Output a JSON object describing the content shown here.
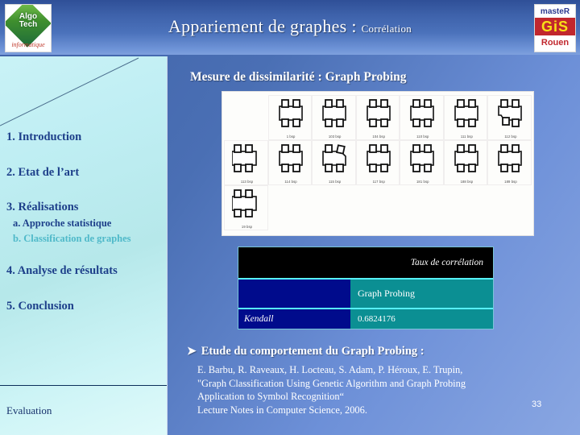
{
  "header": {
    "title_main": "Appariement de graphes : ",
    "title_sub": "Corrélation",
    "logo_left": {
      "name": "algotech-logo",
      "line1": "Algo",
      "line2": "Tech",
      "script": "informatique"
    },
    "logo_right": {
      "name": "master-gis-rouen-logo",
      "line1": "masteR",
      "line2": "GiS",
      "line3": "Rouen"
    }
  },
  "sidebar": {
    "items": [
      {
        "label": "1. Introduction",
        "level": 0,
        "highlight": false
      },
      {
        "label": "2. Etat de l’art",
        "level": 0,
        "highlight": false
      },
      {
        "label": "3. Réalisations",
        "level": 0,
        "highlight": false
      },
      {
        "label": "a. Approche statistique",
        "level": 1,
        "highlight": false
      },
      {
        "label": "b. Classification de graphes",
        "level": 1,
        "highlight": true
      },
      {
        "label": "4. Analyse de résultats",
        "level": 0,
        "highlight": false
      },
      {
        "label": "5. Conclusion",
        "level": 0,
        "highlight": false
      }
    ],
    "footer_label": "Evaluation"
  },
  "main": {
    "content_title": "Mesure de dissimilarité : Graph Probing",
    "symbol_panel": {
      "name": "symbol-image-grid",
      "captions_row1": [
        "",
        "1 bsp",
        "103 bsp",
        "104 bsp",
        "110 bsp",
        "111 bsp",
        "112 bsp"
      ],
      "captions_row2": [
        "113 bsp",
        "114 bsp",
        "115 bsp",
        "117 bsp",
        "181 bsp",
        "188 bsp",
        "189 bsp"
      ],
      "captions_row3": [
        "19 bsp",
        "",
        "",
        "",
        "",
        "",
        ""
      ]
    },
    "table": {
      "header_label": "Taux de corrélation",
      "rows": [
        {
          "label": "",
          "value": "Graph Probing"
        },
        {
          "label": "Kendall",
          "value": "0.6824176"
        }
      ]
    },
    "bullet": {
      "marker": "➤",
      "text": "Etude du comportement du Graph Probing :"
    },
    "citation": {
      "line1": "E. Barbu, R. Raveaux, H. Locteau, S. Adam, P. Héroux, E. Trupin,",
      "line2": "\"Graph Classification Using Genetic Algorithm and Graph Probing",
      "line3": "Application to Symbol Recognition“",
      "line4": "Lecture Notes in Computer Science, 2006."
    },
    "slide_number": "33"
  },
  "colors": {
    "background_blue": "#4a6fb4",
    "sidebar_cyan": "#bfeef3",
    "toc_navy": "#1d3f8a",
    "toc_highlight": "#4fb9c9",
    "table_black": "#000000",
    "table_navy": "#000b8c",
    "table_teal": "#0b8f93",
    "table_border_cyan": "#57f0f5"
  }
}
